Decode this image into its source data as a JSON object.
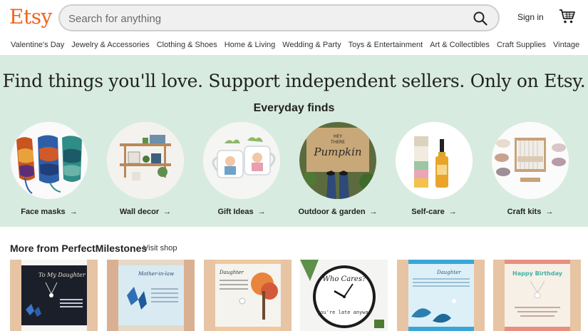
{
  "header": {
    "logo": "Etsy",
    "search_placeholder": "Search for anything",
    "search_icon": "search-icon",
    "signin_label": "Sign in",
    "cart_icon": "cart-icon"
  },
  "nav": {
    "items": [
      {
        "label": "Valentine's Day"
      },
      {
        "label": "Jewelry & Accessories"
      },
      {
        "label": "Clothing & Shoes"
      },
      {
        "label": "Home & Living"
      },
      {
        "label": "Wedding & Party"
      },
      {
        "label": "Toys & Entertainment"
      },
      {
        "label": "Art & Collectibles"
      },
      {
        "label": "Craft Supplies"
      },
      {
        "label": "Vintage"
      }
    ]
  },
  "hero": {
    "title": "Find things you'll love. Support independent sellers. Only on Etsy.",
    "subtitle": "Everyday finds",
    "categories": [
      {
        "label": "Face masks"
      },
      {
        "label": "Wall decor"
      },
      {
        "label": "Gift Ideas"
      },
      {
        "label": "Outdoor & garden"
      },
      {
        "label": "Self-care"
      },
      {
        "label": "Craft kits"
      }
    ],
    "arrow": "→",
    "doormat_text": [
      "HEY",
      "THERE",
      "Pumpkin"
    ]
  },
  "more": {
    "title": "More from PerfectMilestones",
    "visit_shop": "Visit shop",
    "product_texts": {
      "p1": "To My Daughter",
      "p2": "Mother-in-law",
      "p3": "Daughter",
      "p4_top": "Who Cares?",
      "p4_bottom": "you're late anyway",
      "p5": "Daughter",
      "p6": "Happy Birthday"
    }
  },
  "colors": {
    "brand": "#F1641E",
    "hero_bg": "#D8EBE0"
  }
}
